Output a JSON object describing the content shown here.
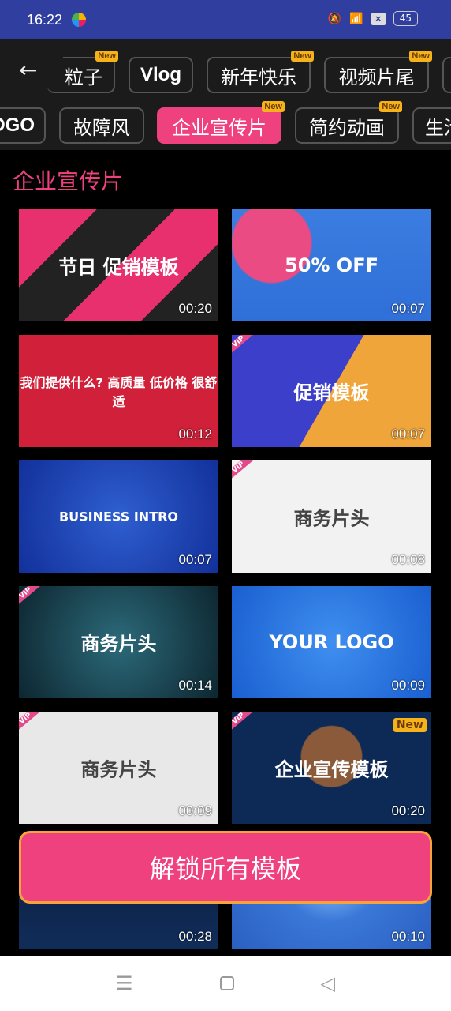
{
  "status_bar": {
    "time": "16:22",
    "battery": "45",
    "icons": [
      "app-icon",
      "mute-icon",
      "wifi-icon",
      "x-notification-icon",
      "battery-icon"
    ]
  },
  "categories_row1": [
    {
      "label": "粒子",
      "new": true
    },
    {
      "label": "Vlog",
      "new": false
    },
    {
      "label": "新年快乐",
      "new": true
    },
    {
      "label": "视频片尾",
      "new": true
    },
    {
      "label": "",
      "new": false
    }
  ],
  "categories_row2": [
    {
      "label": "OGO",
      "new": false
    },
    {
      "label": "故障风",
      "new": false
    },
    {
      "label": "企业宣传片",
      "new": true,
      "active": true
    },
    {
      "label": "简约动画",
      "new": true
    },
    {
      "label": "生活",
      "new": false
    }
  ],
  "new_badge": "New",
  "section_title": "企业宣传片",
  "templates": [
    {
      "caption": "节日 促销模板",
      "duration": "00:20",
      "vip": false,
      "new": false,
      "bg": "linear-gradient(135deg,#e8306f 25%,#222 25% 50%,#e8306f 50% 75%,#222 75%)"
    },
    {
      "caption": "50% OFF",
      "duration": "00:07",
      "vip": false,
      "new": false,
      "bg": "radial-gradient(circle at 20% 30%,#e94b82 22%,transparent 23%),linear-gradient(#3b7de0,#2f6fd8)"
    },
    {
      "caption": "我们提供什么? 高质量 低价格 很舒适",
      "duration": "00:12",
      "vip": false,
      "new": false,
      "bg": "#d0203a"
    },
    {
      "caption": "促销模板",
      "duration": "00:07",
      "vip": true,
      "new": false,
      "bg": "linear-gradient(120deg,#3b3fc9 50%,#f0a53a 50%)"
    },
    {
      "caption": "BUSINESS INTRO",
      "duration": "00:07",
      "vip": false,
      "new": false,
      "bg": "radial-gradient(circle,#2f5fd0,#12309a)"
    },
    {
      "caption": "商务片头",
      "duration": "00:08",
      "vip": true,
      "new": false,
      "bg": "#f2f2f2"
    },
    {
      "caption": "商务片头",
      "duration": "00:14",
      "vip": true,
      "new": false,
      "bg": "radial-gradient(circle,#2c6a7a,#0d2630)"
    },
    {
      "caption": "YOUR LOGO",
      "duration": "00:09",
      "vip": false,
      "new": false,
      "bg": "radial-gradient(circle,#3f8ff0,#1a5fd0)"
    },
    {
      "caption": "商务片头",
      "duration": "00:09",
      "vip": true,
      "new": false,
      "bg": "#e8e8e8"
    },
    {
      "caption": "企业宣传模板",
      "duration": "00:20",
      "vip": true,
      "new": true,
      "bg": "radial-gradient(circle at 50% 40%,#8a5a3a 25%,#0c2a55 26%)"
    },
    {
      "caption": "",
      "duration": "00:28",
      "vip": false,
      "new": false,
      "bg": "linear-gradient(#0b1c3a,#102d5a)"
    },
    {
      "caption": "",
      "duration": "00:10",
      "vip": false,
      "new": false,
      "bg": "radial-gradient(circle at 50% 30%,#9fd0ff,#3a78d8 40%,#2a5fc0)"
    }
  ],
  "unlock_button": "解锁所有模板"
}
